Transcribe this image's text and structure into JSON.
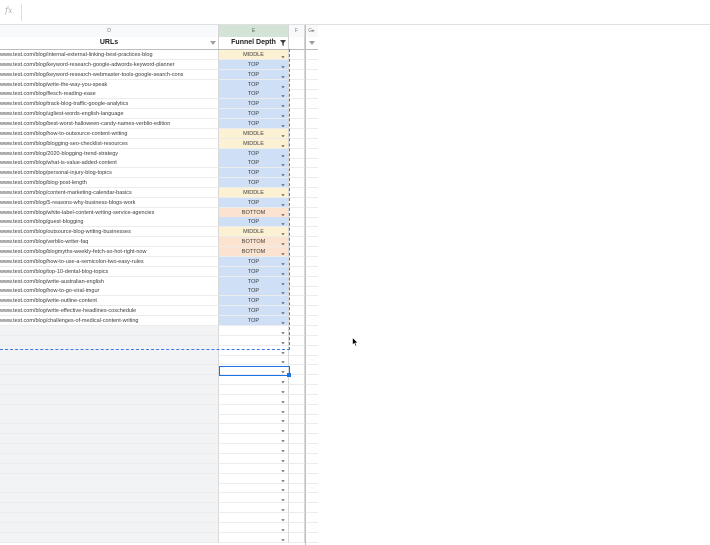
{
  "formula_bar": {
    "fx_label": "fx",
    "value": ""
  },
  "columns": {
    "d": "D",
    "e": "E",
    "f": "F",
    "g": "G"
  },
  "headers": {
    "urls": "URLs",
    "funnel_depth": "Funnel Depth"
  },
  "rows": [
    {
      "url": "www.test.com/blog/internal-external-linking-best-practices-blog",
      "depth": "MIDDLE"
    },
    {
      "url": "www.test.com/blog/keyword-research-google-adwords-keyword-planner",
      "depth": "TOP"
    },
    {
      "url": "www.test.com/blog/keyword-research-webmaster-tools-google-search-cons",
      "depth": "TOP"
    },
    {
      "url": "www.test.com/blog/write-the-way-you-speak",
      "depth": "TOP"
    },
    {
      "url": "www.test.com/blog/flesch-reading-ease",
      "depth": "TOP"
    },
    {
      "url": "www.test.com/blog/track-blog-traffic-google-analytics",
      "depth": "TOP"
    },
    {
      "url": "www.test.com/blog/ugliest-words-english-language",
      "depth": "TOP"
    },
    {
      "url": "www.test.com/blog/best-worst-halloween-candy-names-verblio-edition",
      "depth": "TOP"
    },
    {
      "url": "www.test.com/blog/how-to-outsource-content-writing",
      "depth": "MIDDLE"
    },
    {
      "url": "www.test.com/blog/blogging-seo-checklist-resources",
      "depth": "MIDDLE"
    },
    {
      "url": "www.test.com/blog/2020-blogging-trend-strategy",
      "depth": "TOP"
    },
    {
      "url": "www.test.com/blog/what-is-value-added-content",
      "depth": "TOP"
    },
    {
      "url": "www.test.com/blog/personal-injury-blog-topics",
      "depth": "TOP"
    },
    {
      "url": "www.test.com/blog/blog-post-length",
      "depth": "TOP"
    },
    {
      "url": "www.test.com/blog/content-marketing-calendar-basics",
      "depth": "MIDDLE"
    },
    {
      "url": "www.test.com/blog/5-reasons-why-business-blogs-work",
      "depth": "TOP"
    },
    {
      "url": "www.test.com/blog/white-label-content-writing-service-agencies",
      "depth": "BOTTOM"
    },
    {
      "url": "www.test.com/blog/guest-blogging",
      "depth": "TOP"
    },
    {
      "url": "www.test.com/blog/outsource-blog-writing-businesses",
      "depth": "MIDDLE"
    },
    {
      "url": "www.test.com/blog/verblio-writer-faq",
      "depth": "BOTTOM"
    },
    {
      "url": "www.test.com/blog/blogmyths-weekly-fetch-so-hot-right-now",
      "depth": "BOTTOM"
    },
    {
      "url": "www.test.com/blog/how-to-use-a-semicolon-two-easy-rules",
      "depth": "TOP"
    },
    {
      "url": "www.test.com/blog/top-10-dental-blog-topics",
      "depth": "TOP"
    },
    {
      "url": "www.test.com/blog/write-australian-english",
      "depth": "TOP"
    },
    {
      "url": "www.test.com/blog/how-to-go-viral-imgur",
      "depth": "TOP"
    },
    {
      "url": "www.test.com/blog/write-outline-content",
      "depth": "TOP"
    },
    {
      "url": "www.test.com/blog/write-effective-headlines-coschedule",
      "depth": "TOP"
    },
    {
      "url": "www.test.com/blog/challenges-of-medical-content-writing",
      "depth": "TOP"
    }
  ],
  "empty_rows": 22,
  "colors": {
    "top": "#cfdff6",
    "middle": "#fdf1d4",
    "bottom": "#fbe3cf",
    "selection": "#1a73e8"
  }
}
